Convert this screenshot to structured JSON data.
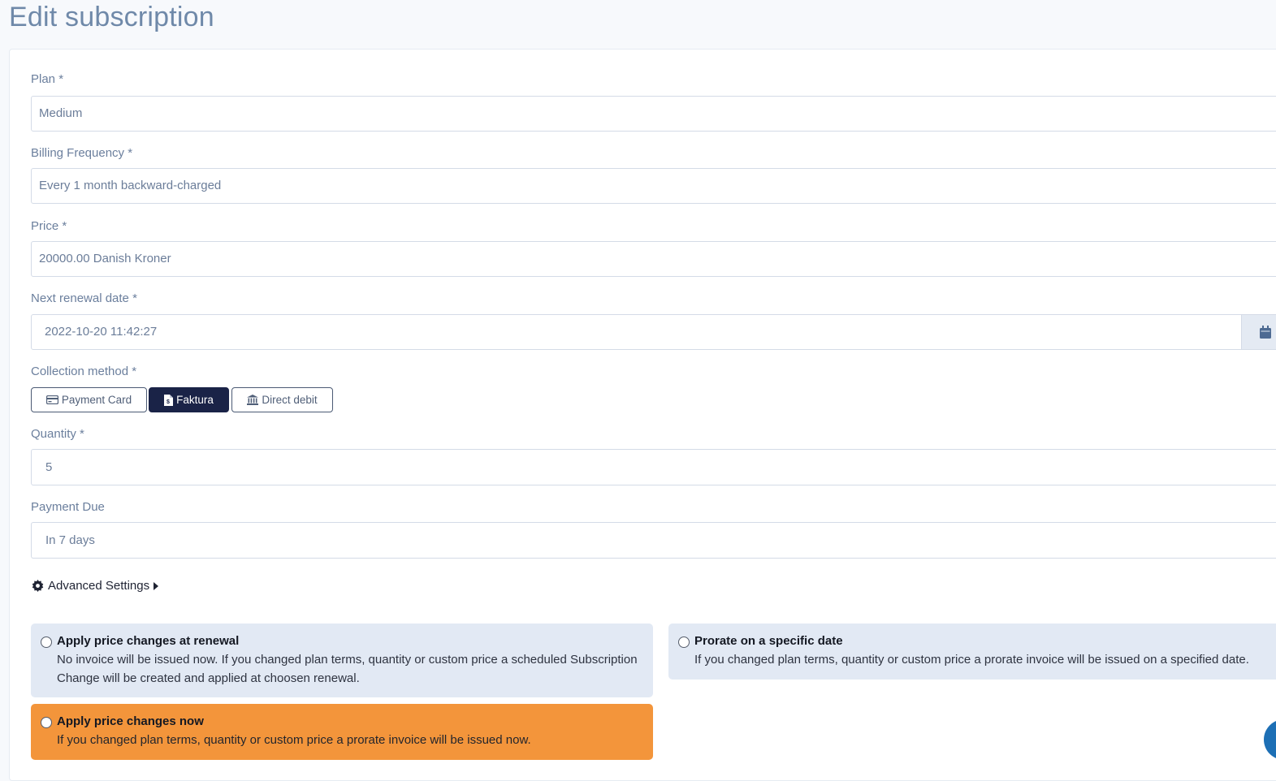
{
  "page": {
    "title": "Edit subscription"
  },
  "form": {
    "plan": {
      "label": "Plan *",
      "value": "Medium"
    },
    "billing_frequency": {
      "label": "Billing Frequency *",
      "value": "Every 1 month backward-charged"
    },
    "price": {
      "label": "Price *",
      "value": "20000.00 Danish Kroner"
    },
    "next_renewal": {
      "label": "Next renewal date *",
      "value": "2022-10-20 11:42:27",
      "icon": "calendar-icon"
    },
    "collection_method": {
      "label": "Collection method *",
      "options": [
        {
          "label": "Payment Card",
          "icon": "credit-card-icon",
          "selected": false
        },
        {
          "label": "Faktura",
          "icon": "invoice-file-icon",
          "selected": true
        },
        {
          "label": "Direct debit",
          "icon": "bank-icon",
          "selected": false
        }
      ]
    },
    "quantity": {
      "label": "Quantity *",
      "value": "5"
    },
    "payment_due": {
      "label": "Payment Due",
      "value": "In 7 days",
      "icon": "chevron-down-icon"
    },
    "advanced_settings": {
      "label": "Advanced Settings",
      "icon": "gear-icon",
      "expanded": false
    }
  },
  "price_change_options": [
    {
      "title": "Apply price changes at renewal",
      "description": "No invoice will be issued now. If you changed plan terms, quantity or custom price a scheduled Subscription Change will be created and applied at choosen renewal.",
      "selected": false
    },
    {
      "title": "Prorate on a specific date",
      "description": "If you changed plan terms, quantity or custom price a prorate invoice will be issued on a specified date.",
      "selected": false
    },
    {
      "title": "Apply price changes now",
      "description": "If you changed plan terms, quantity or custom price a prorate invoice will be issued now.",
      "selected": false,
      "highlight_color": "#f3953b"
    }
  ],
  "colors": {
    "primary_dark": "#1a2347",
    "highlight_orange": "#f3953b",
    "option_blue": "#e2e9f4",
    "chat_button": "#1d6fb5"
  }
}
